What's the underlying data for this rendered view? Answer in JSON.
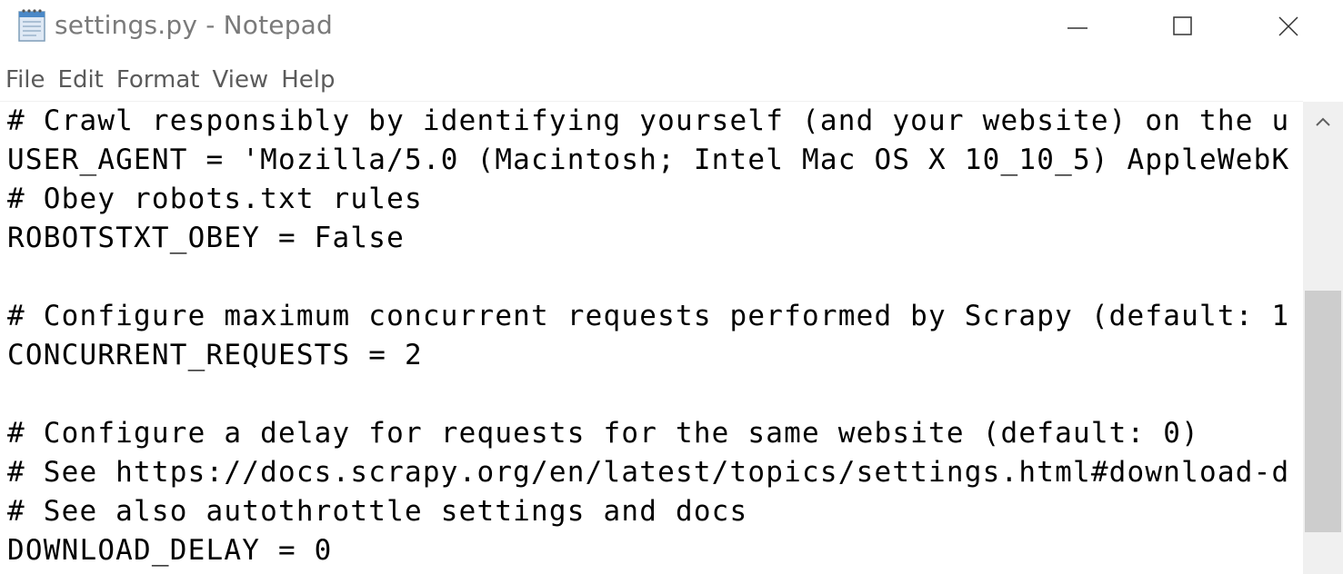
{
  "window": {
    "title": "settings.py - Notepad",
    "icon": "notepad-icon"
  },
  "controls": {
    "minimize_icon": "minimize-icon",
    "maximize_icon": "maximize-icon",
    "close_icon": "close-icon"
  },
  "menu": {
    "items": [
      {
        "label": "File"
      },
      {
        "label": "Edit"
      },
      {
        "label": "Format"
      },
      {
        "label": "View"
      },
      {
        "label": "Help"
      }
    ]
  },
  "editor": {
    "lines": [
      "# Crawl responsibly by identifying yourself (and your website) on the u",
      "USER_AGENT = 'Mozilla/5.0 (Macintosh; Intel Mac OS X 10_10_5) AppleWebK",
      "# Obey robots.txt rules",
      "ROBOTSTXT_OBEY = False",
      "",
      "# Configure maximum concurrent requests performed by Scrapy (default: 1",
      "CONCURRENT_REQUESTS = 2",
      "",
      "# Configure a delay for requests for the same website (default: 0)",
      "# See https://docs.scrapy.org/en/latest/topics/settings.html#download-d",
      "# See also autothrottle settings and docs",
      "DOWNLOAD_DELAY = 0"
    ]
  },
  "colors": {
    "title_text": "#7a7a7a",
    "menu_text": "#5b5b5b",
    "scrollbar_track": "#f0f0f0",
    "scrollbar_thumb": "#cdcdcd"
  }
}
